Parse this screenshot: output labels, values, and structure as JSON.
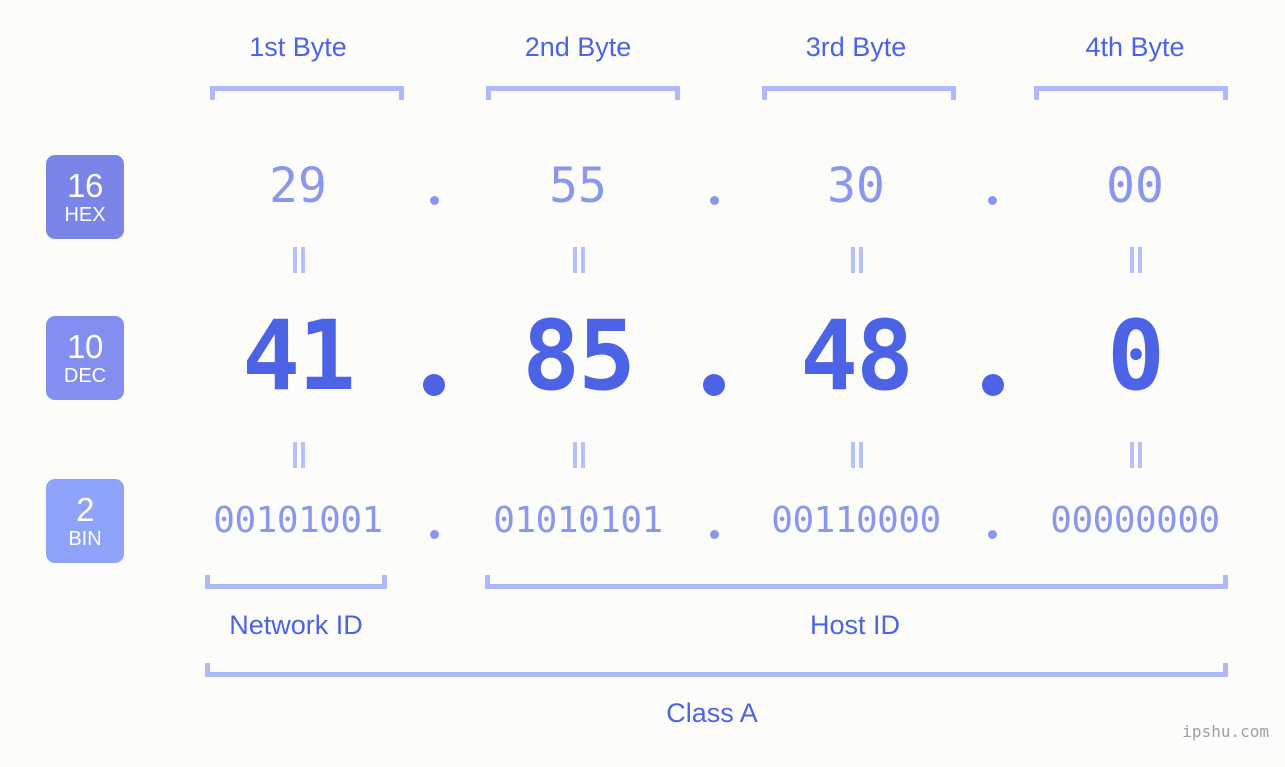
{
  "meta": {
    "background_color": "#fcfdfa",
    "accent_strong": "#4c63e6",
    "accent_light": "#8b96ee",
    "bracket_color": "#aeb8fb",
    "watermark": "ipshu.com"
  },
  "headers": [
    {
      "label": "1st Byte"
    },
    {
      "label": "2nd Byte"
    },
    {
      "label": "3rd Byte"
    },
    {
      "label": "4th Byte"
    }
  ],
  "bases": [
    {
      "number": "16",
      "abbr": "HEX",
      "color": "#7b85e8"
    },
    {
      "number": "10",
      "abbr": "DEC",
      "color": "#838ff0"
    },
    {
      "number": "2",
      "abbr": "BIN",
      "color": "#8fa3fa"
    }
  ],
  "separator": ".",
  "rows": {
    "hex": {
      "base_label": "HEX",
      "values": [
        "29",
        "55",
        "30",
        "00"
      ]
    },
    "dec": {
      "base_label": "DEC",
      "values": [
        "41",
        "85",
        "48",
        "0"
      ]
    },
    "bin": {
      "base_label": "BIN",
      "values": [
        "00101001",
        "01010101",
        "00110000",
        "00000000"
      ]
    }
  },
  "equals_symbol": "=",
  "sections": {
    "network_id": "Network ID",
    "host_id": "Host ID",
    "class": "Class A"
  },
  "address": {
    "hex": "29.55.30.00",
    "dec": "41.85.48.0",
    "bin": "00101001.01010101.00110000.00000000"
  }
}
